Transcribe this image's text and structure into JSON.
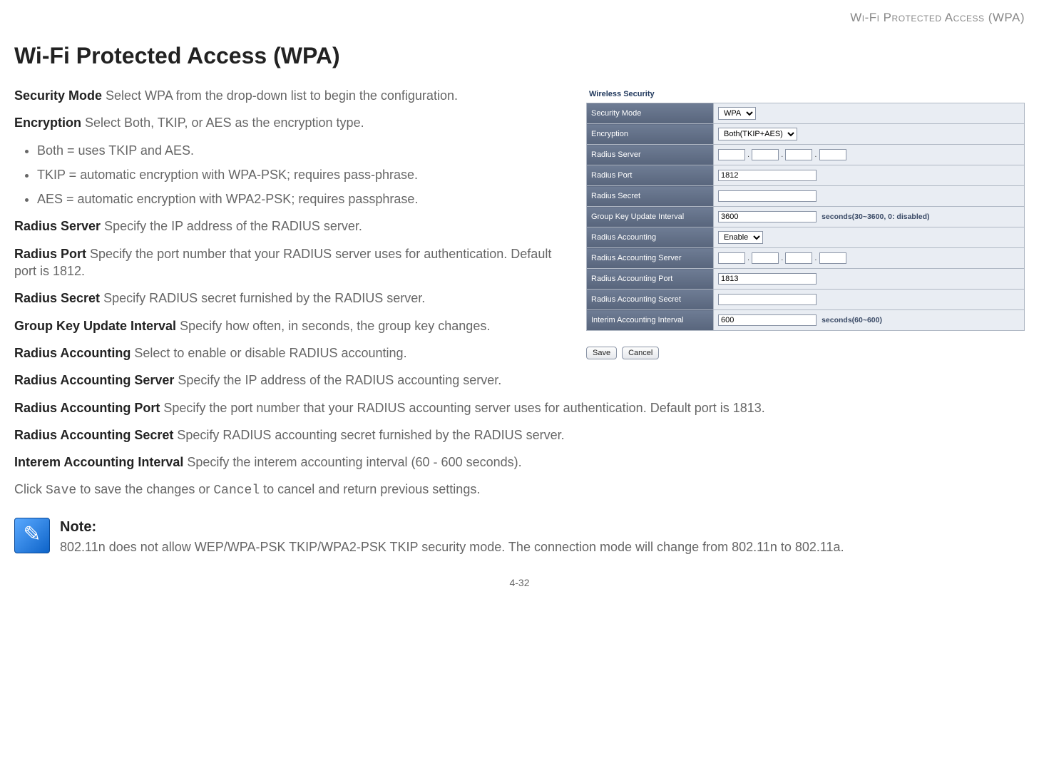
{
  "header": {
    "running_head": "Wi-Fi Protected Access (WPA)"
  },
  "title": "Wi-Fi Protected Access (WPA)",
  "screenshot": {
    "panel_title": "Wireless Security",
    "rows": {
      "security_mode": {
        "label": "Security Mode",
        "value": "WPA"
      },
      "encryption": {
        "label": "Encryption",
        "value": "Both(TKIP+AES)"
      },
      "radius_server": {
        "label": "Radius Server"
      },
      "radius_port": {
        "label": "Radius Port",
        "value": "1812"
      },
      "radius_secret": {
        "label": "Radius Secret"
      },
      "group_key": {
        "label": "Group Key Update Interval",
        "value": "3600",
        "suffix": "seconds(30~3600, 0: disabled)"
      },
      "radius_accounting": {
        "label": "Radius Accounting",
        "value": "Enable"
      },
      "radius_acct_server": {
        "label": "Radius Accounting Server"
      },
      "radius_acct_port": {
        "label": "Radius Accounting Port",
        "value": "1813"
      },
      "radius_acct_secret": {
        "label": "Radius Accounting Secret"
      },
      "interim": {
        "label": "Interim Accounting Interval",
        "value": "600",
        "suffix": "seconds(60~600)"
      }
    },
    "buttons": {
      "save": "Save",
      "cancel": "Cancel"
    }
  },
  "body": {
    "p_security_mode_label": "Security Mode",
    "p_security_mode_text": "  Select WPA from the drop-down list to begin the configuration.",
    "p_encryption_label": "Encryption",
    "p_encryption_text": "  Select Both, TKIP, or AES as the encryption type.",
    "bullets": [
      "Both = uses TKIP and AES.",
      "TKIP = automatic encryption with WPA-PSK; requires pass-phrase.",
      "AES = automatic encryption with WPA2-PSK; requires passphrase."
    ],
    "p_radius_server_label": "Radius Server",
    "p_radius_server_text": "  Specify the IP address of the RADIUS server.",
    "p_radius_port_label": "Radius Port",
    "p_radius_port_text": "  Specify the port number that your RADIUS server uses for authentication. Default port is 1812.",
    "p_radius_secret_label": "Radius Secret",
    "p_radius_secret_text": "  Specify RADIUS secret furnished by the RADIUS server.",
    "p_group_key_label": "Group Key Update Interval",
    "p_group_key_text": "  Specify how often, in seconds, the group key changes.",
    "p_radius_acct_label": "Radius Accounting",
    "p_radius_acct_text": "  Select to enable or disable RADIUS accounting.",
    "p_radius_acct_server_label": "Radius Accounting Server",
    "p_radius_acct_server_text": "  Specify the IP address of the RADIUS accounting server.",
    "p_radius_acct_port_label": "Radius Accounting Port",
    "p_radius_acct_port_text": "  Specify the port number that your RADIUS accounting server uses for authentication. Default port is 1813.",
    "p_radius_acct_secret_label": "Radius Accounting Secret",
    "p_radius_acct_secret_text": "  Specify RADIUS accounting secret furnished by the RADIUS server.",
    "p_interem_label": "Interem Accounting Interval",
    "p_interem_text": "  Specify the interem accounting interval (60 - 600 seconds).",
    "p_click_1": "Click ",
    "p_click_save": "Save",
    "p_click_2": " to save the changes or ",
    "p_click_cancel": "Cancel",
    "p_click_3": " to cancel and return previous settings."
  },
  "note": {
    "heading": "Note:",
    "text": "802.11n does not allow WEP/WPA-PSK TKIP/WPA2-PSK TKIP security mode. The connection mode will change from 802.11n to 802.11a."
  },
  "footer": {
    "page": "4-32"
  }
}
